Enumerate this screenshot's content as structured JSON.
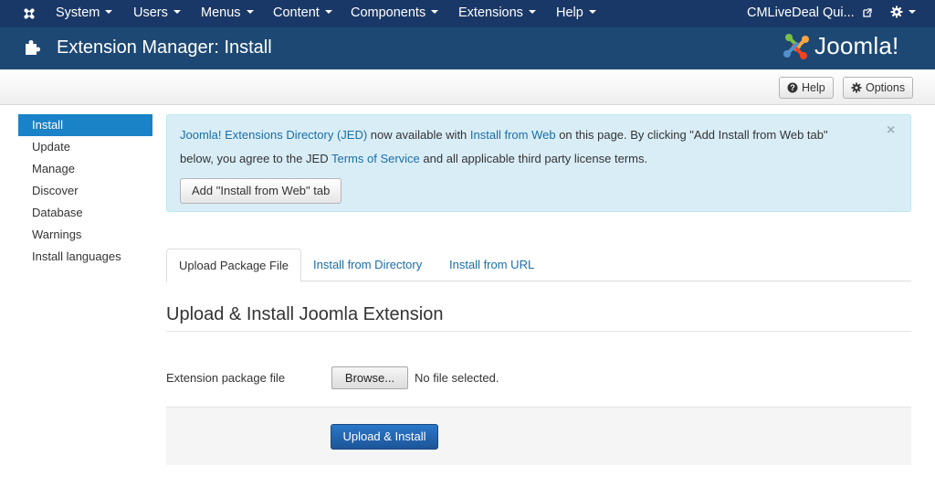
{
  "navbar": {
    "menus": [
      {
        "label": "System"
      },
      {
        "label": "Users"
      },
      {
        "label": "Menus"
      },
      {
        "label": "Content"
      },
      {
        "label": "Components"
      },
      {
        "label": "Extensions"
      },
      {
        "label": "Help"
      }
    ],
    "site_link": "CMLiveDeal Qui...",
    "site_link_icon": "external-link-icon",
    "settings_icon": "gear-icon"
  },
  "header": {
    "icon": "puzzle-piece-icon",
    "title": "Extension Manager: Install",
    "brand": "Joomla!"
  },
  "toolbar": {
    "help_label": "Help",
    "options_label": "Options"
  },
  "sidebar": {
    "items": [
      {
        "label": "Install",
        "active": true
      },
      {
        "label": "Update"
      },
      {
        "label": "Manage"
      },
      {
        "label": "Discover"
      },
      {
        "label": "Database"
      },
      {
        "label": "Warnings"
      },
      {
        "label": "Install languages"
      }
    ]
  },
  "alert": {
    "jed_link": "Joomla! Extensions Directory (JED)",
    "text_a": " now available with ",
    "install_web_link": "Install from Web",
    "text_b": " on this page.  By clicking \"Add Install from Web tab\"",
    "text_c": "below, you agree to the JED ",
    "tos_link": "Terms of Service",
    "text_d": " and all applicable third party license terms.",
    "close_glyph": "×",
    "button_label": "Add \"Install from Web\" tab"
  },
  "tabs": [
    {
      "label": "Upload Package File",
      "active": true
    },
    {
      "label": "Install from Directory"
    },
    {
      "label": "Install from URL"
    }
  ],
  "main": {
    "section_title": "Upload & Install Joomla Extension",
    "field_label": "Extension package file",
    "browse_label": "Browse...",
    "file_status": "No file selected.",
    "submit_label": "Upload & Install"
  },
  "colors": {
    "navbar_bg": "#1a3867",
    "header_bg": "#1d4874",
    "sidebar_active": "#1a82c7",
    "alert_bg": "#d9edf7",
    "link": "#1a6ea8",
    "primary_button": "#2a77c9"
  }
}
